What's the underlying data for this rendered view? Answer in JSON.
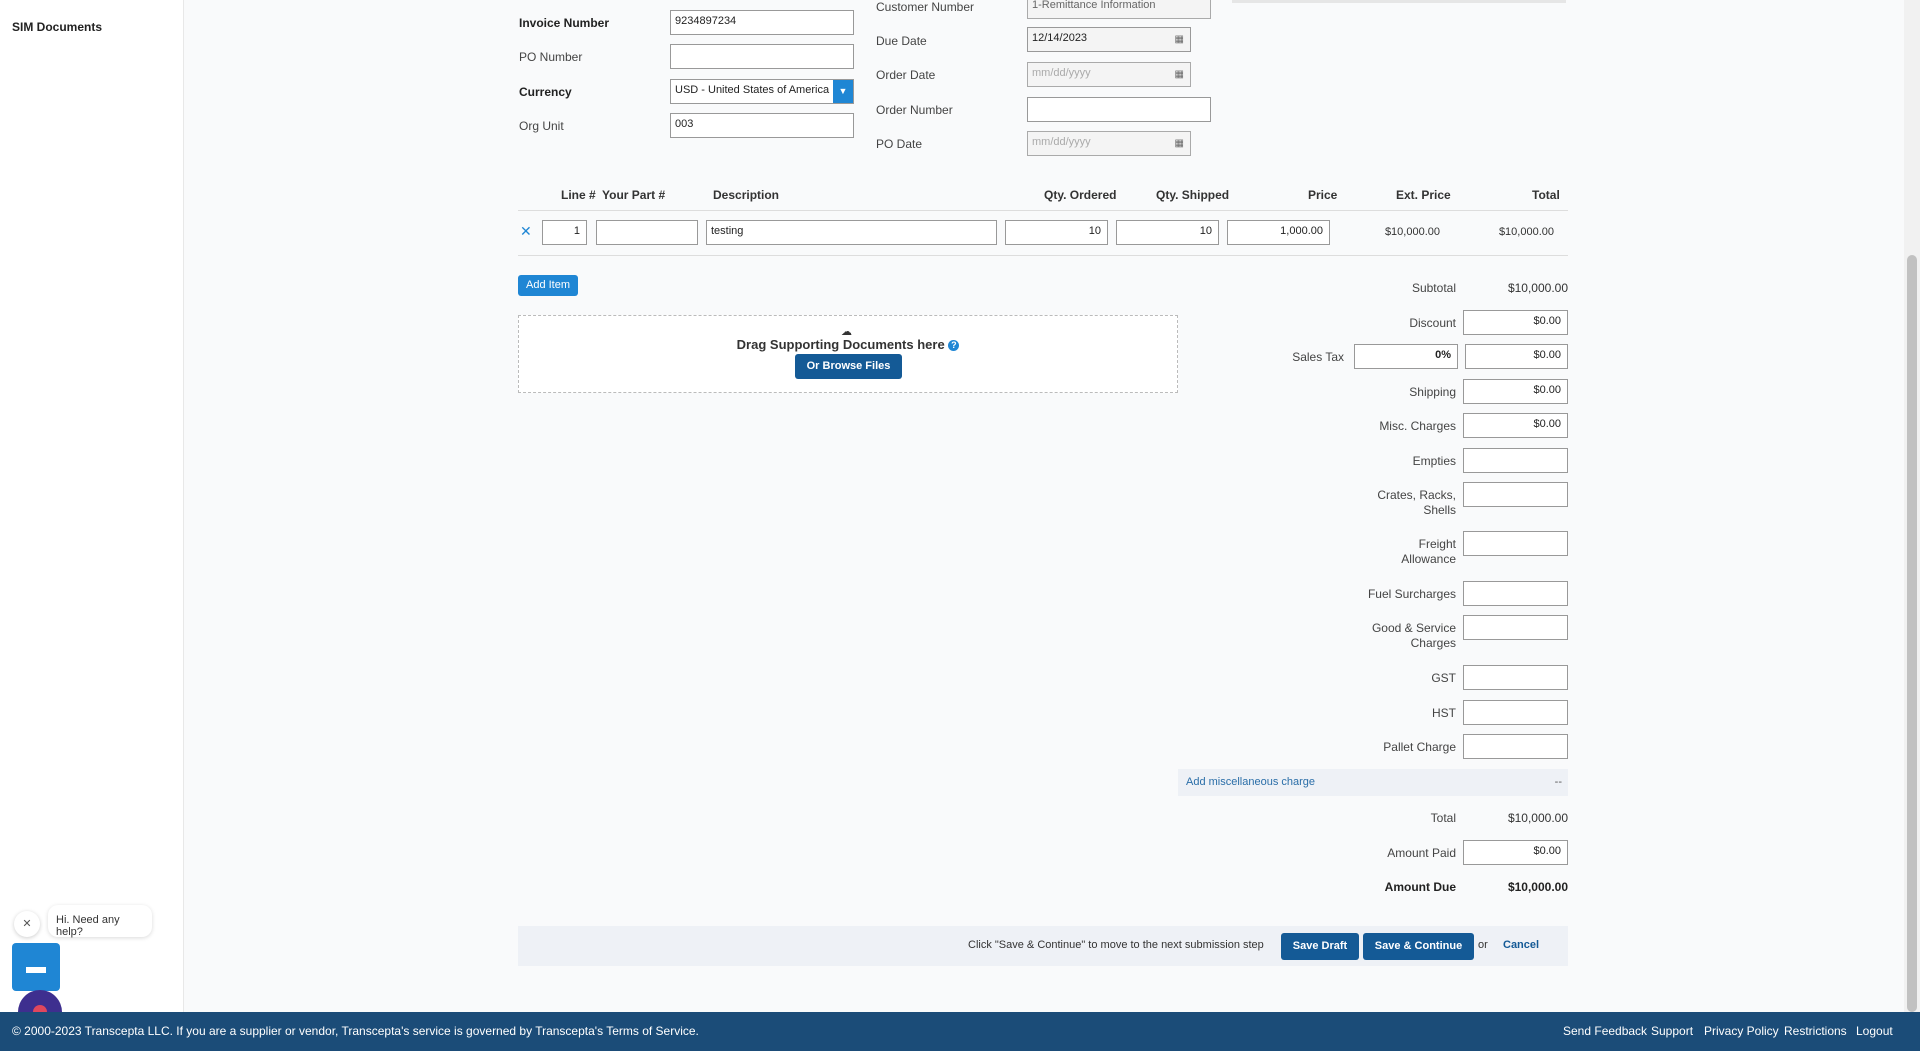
{
  "sidebar": {
    "items": [
      {
        "label": "SIM Documents"
      }
    ]
  },
  "header_fields": {
    "invoice_number": {
      "label": "Invoice Number",
      "value": "9234897234"
    },
    "po_number": {
      "label": "PO Number",
      "value": ""
    },
    "currency": {
      "label": "Currency",
      "value": "USD - United States of America"
    },
    "org_unit": {
      "label": "Org Unit",
      "value": "003"
    },
    "customer_number": {
      "label": "Customer Number",
      "value": "1-Remittance Information"
    },
    "due_date": {
      "label": "Due Date",
      "value": "12/14/2023"
    },
    "order_date": {
      "label": "Order Date",
      "placeholder": "mm/dd/yyyy"
    },
    "order_number": {
      "label": "Order Number",
      "value": ""
    },
    "po_date": {
      "label": "PO Date",
      "placeholder": "mm/dd/yyyy"
    }
  },
  "line_items": {
    "columns": [
      "Line #",
      "Your Part #",
      "Description",
      "Qty. Ordered",
      "Qty. Shipped",
      "Price",
      "Ext. Price",
      "Total"
    ],
    "rows": [
      {
        "line": "1",
        "part": "",
        "description": "testing",
        "qty_ordered": "10",
        "qty_shipped": "10",
        "price": "1,000.00",
        "ext_price": "$10,000.00",
        "total": "$10,000.00"
      }
    ],
    "add_item_label": "Add Item"
  },
  "dropzone": {
    "title": "Drag Supporting Documents here",
    "browse_label": "Or Browse Files"
  },
  "totals": {
    "subtotal": {
      "label": "Subtotal",
      "value": "$10,000.00"
    },
    "discount": {
      "label": "Discount",
      "value": "$0.00"
    },
    "sales_tax": {
      "label": "Sales Tax",
      "percent": "0%",
      "value": "$0.00"
    },
    "shipping": {
      "label": "Shipping",
      "value": "$0.00"
    },
    "misc_charges": {
      "label": "Misc. Charges",
      "value": "$0.00"
    },
    "empties": {
      "label": "Empties",
      "value": ""
    },
    "crates": {
      "label1": "Crates, Racks,",
      "label2": "Shells",
      "value": ""
    },
    "freight": {
      "label1": "Freight",
      "label2": "Allowance",
      "value": ""
    },
    "fuel": {
      "label": "Fuel Surcharges",
      "value": ""
    },
    "goods_service": {
      "label1": "Good & Service",
      "label2": "Charges",
      "value": ""
    },
    "gst": {
      "label": "GST",
      "value": ""
    },
    "hst": {
      "label": "HST",
      "value": ""
    },
    "pallet": {
      "label": "Pallet Charge",
      "value": ""
    },
    "add_misc": {
      "label": "Add miscellaneous charge",
      "value": "--"
    },
    "total": {
      "label": "Total",
      "value": "$10,000.00"
    },
    "amount_paid": {
      "label": "Amount Paid",
      "value": "$0.00"
    },
    "amount_due": {
      "label": "Amount Due",
      "value": "$10,000.00"
    }
  },
  "actions": {
    "hint": "Click \"Save & Continue\" to move to the next submission step",
    "save_draft": "Save Draft",
    "save_continue": "Save & Continue",
    "or": "or",
    "cancel": "Cancel"
  },
  "chat": {
    "bubble": "Hi. Need any help?"
  },
  "footer": {
    "copyright": "© 2000-2023 Transcepta LLC. If you are a supplier or vendor, Transcepta's service is governed by Transcepta's Terms of Service.",
    "links": [
      "Send Feedback",
      "Support",
      "Privacy Policy",
      "Restrictions",
      "Logout"
    ]
  },
  "colors": {
    "primary": "#1f86d4",
    "dark_primary": "#145a96",
    "footer": "#1b4c78"
  }
}
